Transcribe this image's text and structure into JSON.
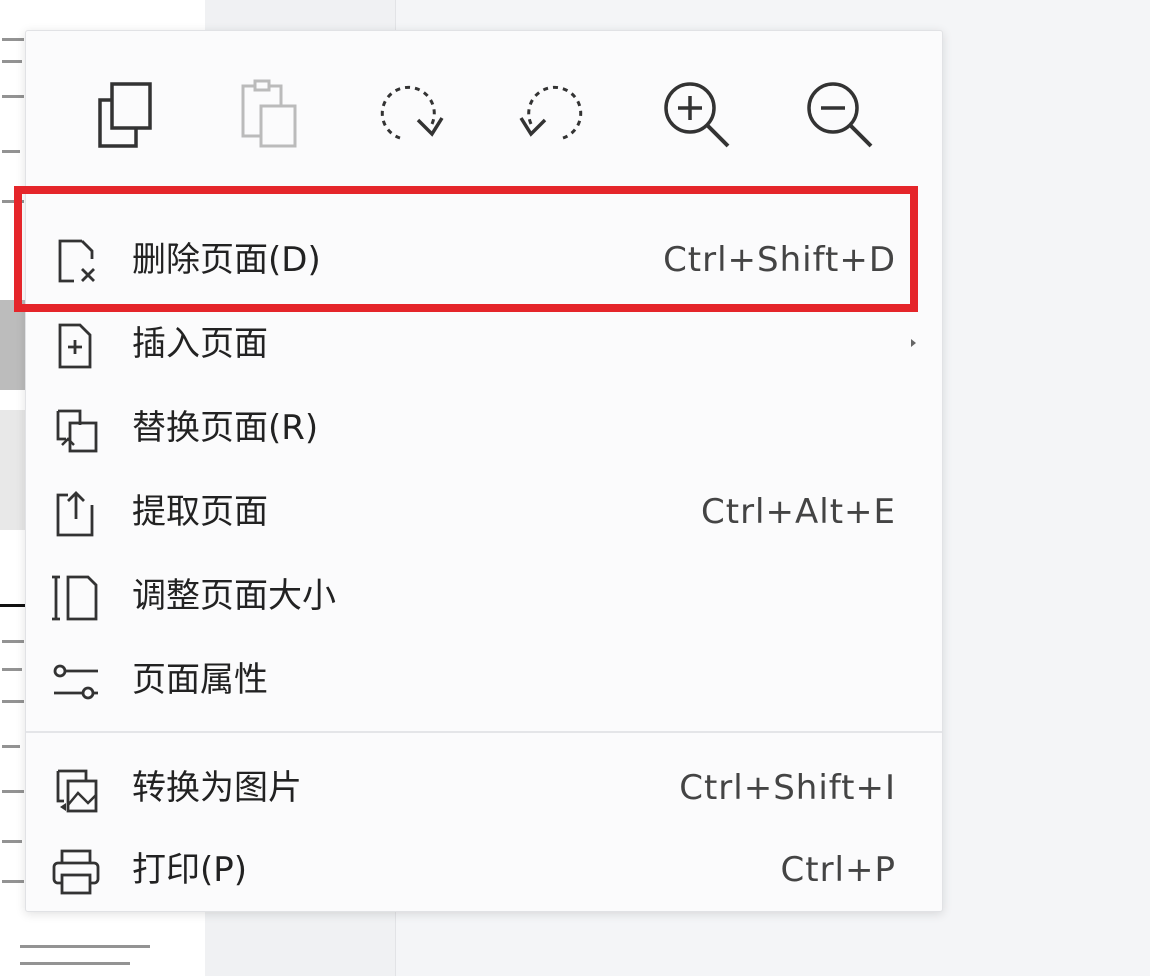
{
  "toolbar": {
    "buttons": [
      {
        "icon": "copy-icon"
      },
      {
        "icon": "paste-icon"
      },
      {
        "icon": "rotate-clockwise-icon"
      },
      {
        "icon": "rotate-counterclockwise-icon"
      },
      {
        "icon": "zoom-in-icon"
      },
      {
        "icon": "zoom-out-icon"
      }
    ]
  },
  "menu": {
    "items": [
      {
        "label": "删除页面(D)",
        "shortcut": "Ctrl+Shift+D",
        "icon": "delete-page-icon",
        "highlighted": true
      },
      {
        "label": "插入页面",
        "shortcut": "",
        "icon": "insert-page-icon",
        "submenu": true
      },
      {
        "label": "替换页面(R)",
        "shortcut": "",
        "icon": "replace-page-icon"
      },
      {
        "label": "提取页面",
        "shortcut": "Ctrl+Alt+E",
        "icon": "extract-page-icon"
      },
      {
        "label": "调整页面大小",
        "shortcut": "",
        "icon": "resize-page-icon"
      },
      {
        "label": "页面属性",
        "shortcut": "",
        "icon": "page-properties-icon"
      },
      {
        "label": "转换为图片",
        "shortcut": "Ctrl+Shift+I",
        "icon": "convert-to-image-icon"
      },
      {
        "label": "打印(P)",
        "shortcut": "Ctrl+P",
        "icon": "print-icon"
      }
    ]
  },
  "colors": {
    "highlight_border": "#e5252a",
    "menu_background": "#fbfbfc",
    "icon_stroke": "#333333"
  }
}
